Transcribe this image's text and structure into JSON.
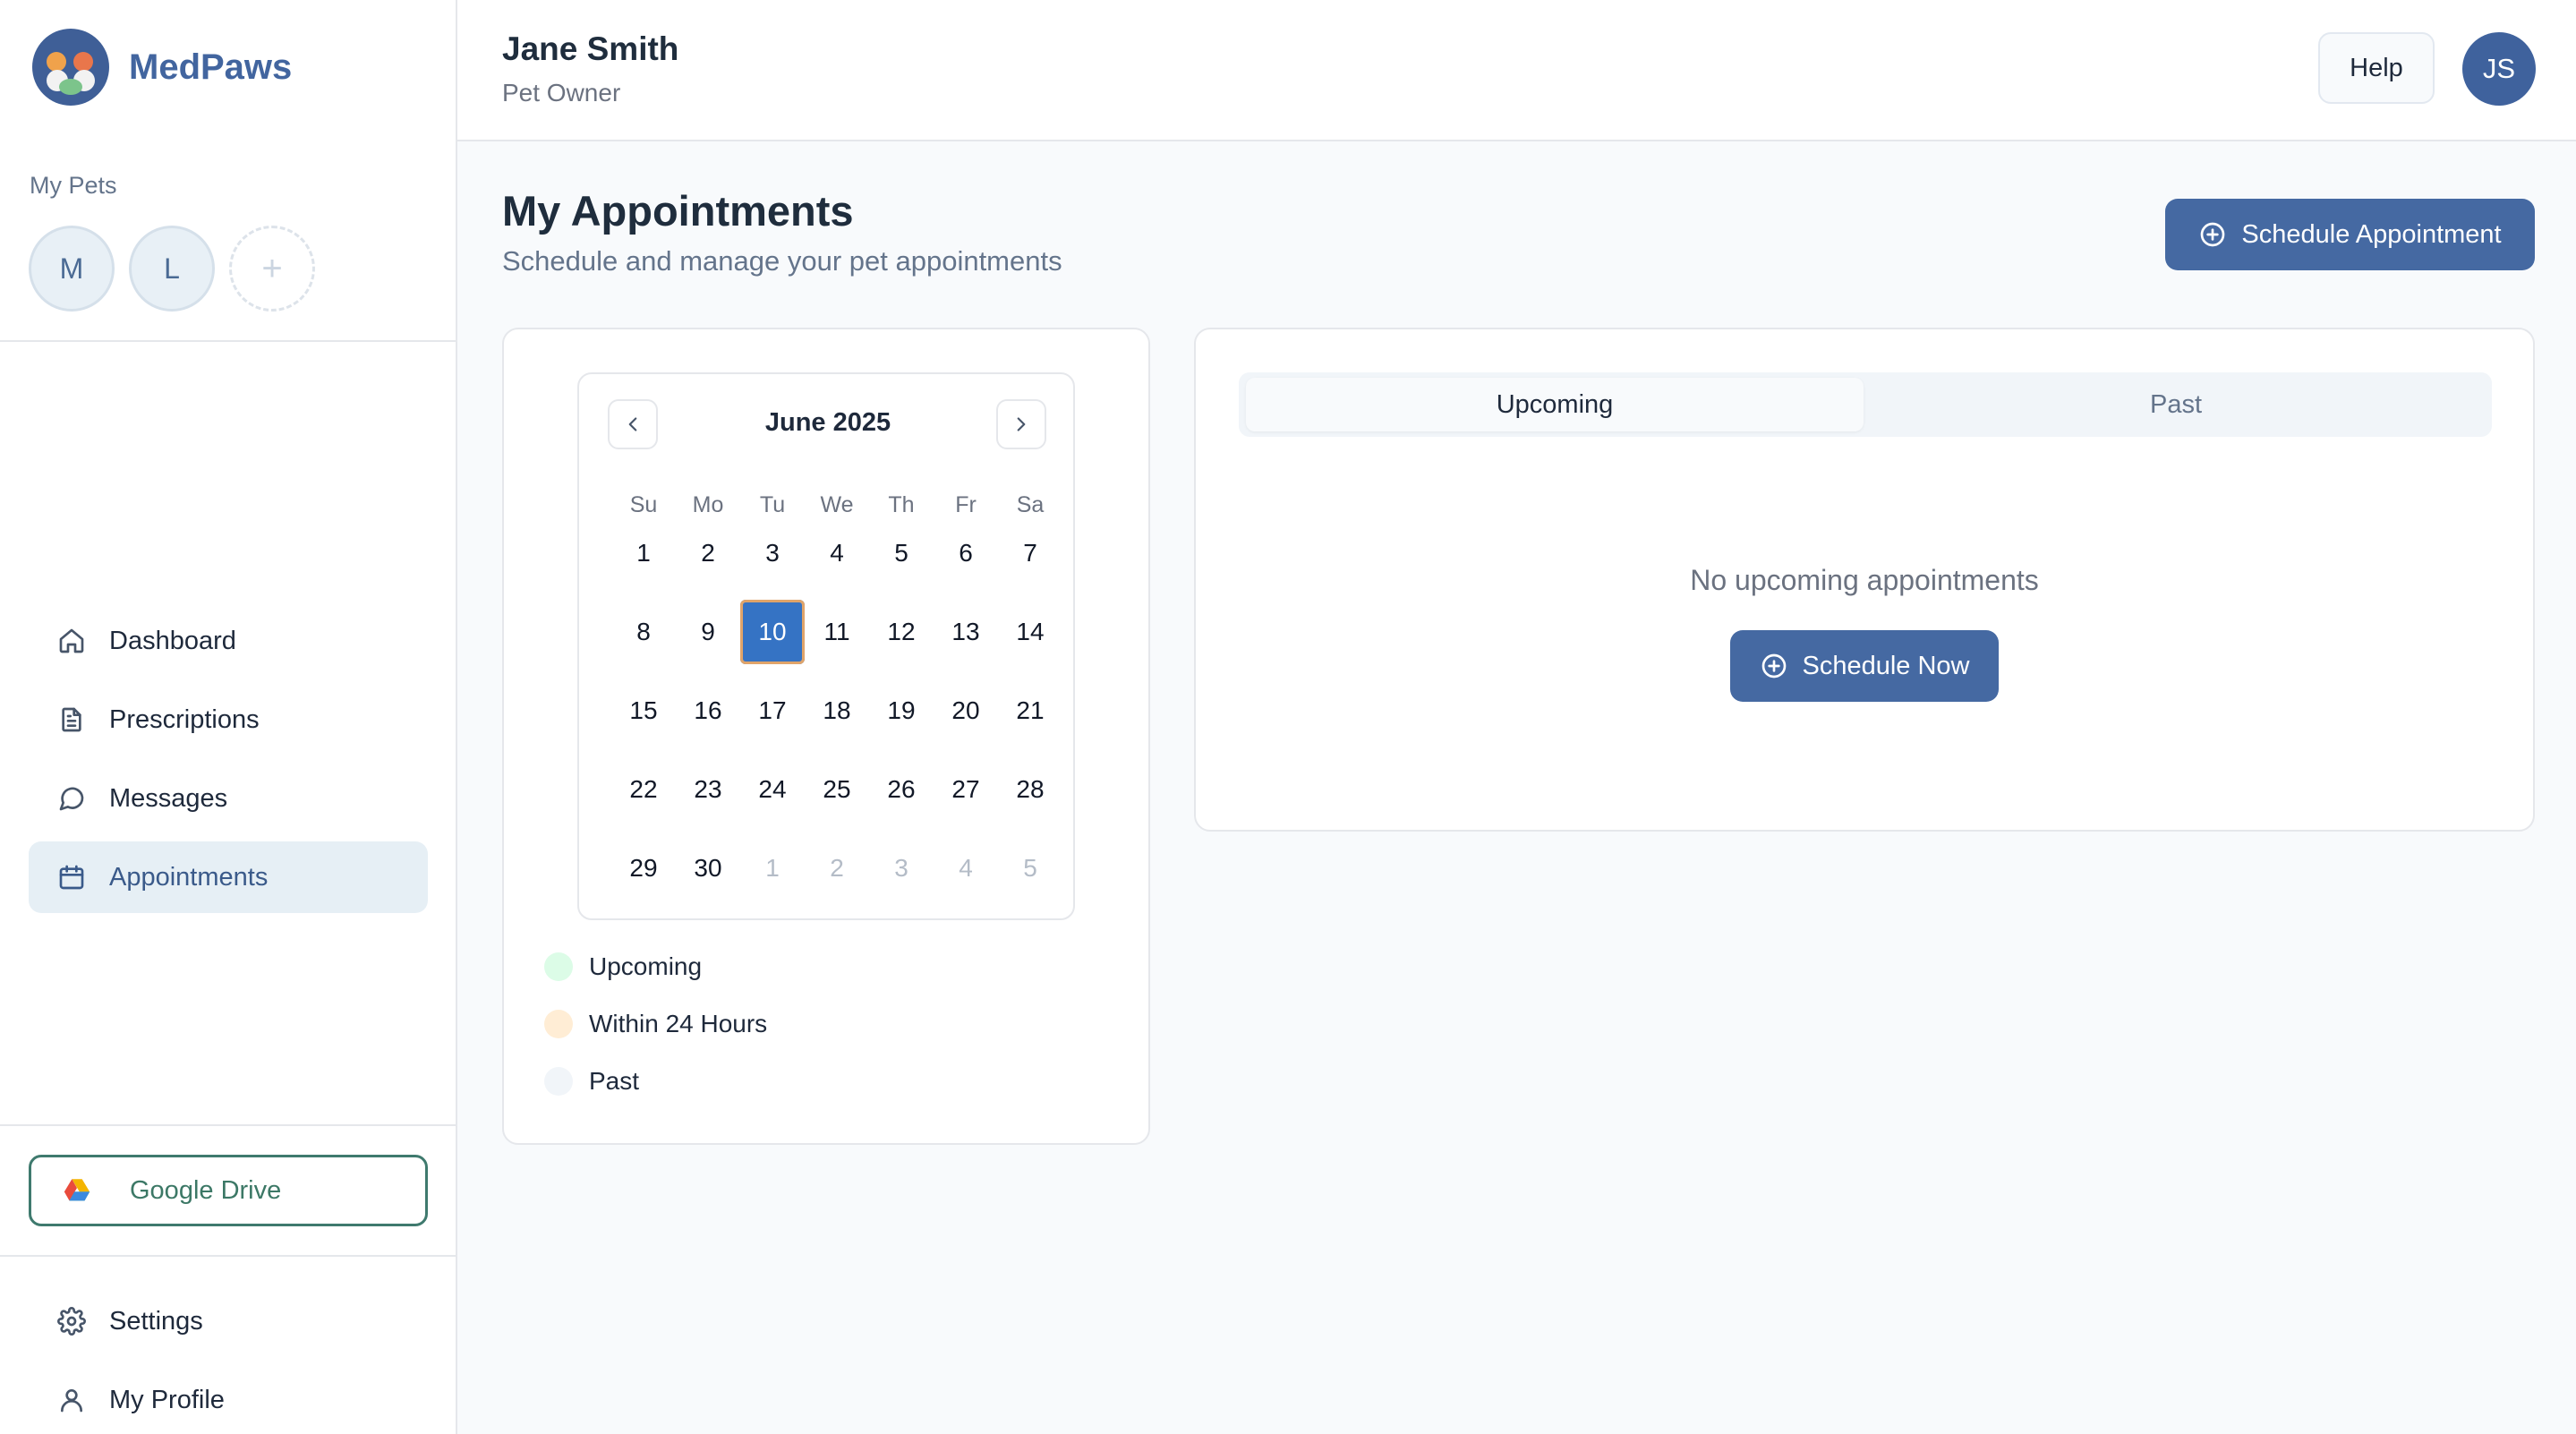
{
  "app": {
    "name": "MedPaws"
  },
  "sidebar": {
    "pets_label": "My Pets",
    "pets": [
      "M",
      "L"
    ],
    "add_pet": "+",
    "nav": [
      {
        "label": "Dashboard",
        "icon": "home-icon"
      },
      {
        "label": "Prescriptions",
        "icon": "document-icon"
      },
      {
        "label": "Messages",
        "icon": "chat-icon"
      },
      {
        "label": "Appointments",
        "icon": "calendar-icon",
        "active": true
      }
    ],
    "gdrive": {
      "label": "Google Drive",
      "icon": "google-drive-icon"
    },
    "bottom_nav": [
      {
        "label": "Settings",
        "icon": "gear-icon"
      },
      {
        "label": "My Profile",
        "icon": "user-icon"
      }
    ]
  },
  "header": {
    "user_name": "Jane Smith",
    "user_role": "Pet Owner",
    "help_label": "Help",
    "avatar_initials": "JS"
  },
  "page": {
    "title": "My Appointments",
    "subtitle": "Schedule and manage your pet appointments",
    "schedule_button": "Schedule Appointment"
  },
  "calendar": {
    "month_label": "June 2025",
    "weekdays": [
      "Su",
      "Mo",
      "Tu",
      "We",
      "Th",
      "Fr",
      "Sa"
    ],
    "weeks": [
      [
        "1",
        "2",
        "3",
        "4",
        "5",
        "6",
        "7"
      ],
      [
        "8",
        "9",
        "10",
        "11",
        "12",
        "13",
        "14"
      ],
      [
        "15",
        "16",
        "17",
        "18",
        "19",
        "20",
        "21"
      ],
      [
        "22",
        "23",
        "24",
        "25",
        "26",
        "27",
        "28"
      ],
      [
        "29",
        "30",
        "1",
        "2",
        "3",
        "4",
        "5"
      ]
    ],
    "selected_day": "10",
    "outside_month_from_index": 30
  },
  "legend": [
    {
      "label": "Upcoming",
      "color": "#dcfce7"
    },
    {
      "label": "Within 24 Hours",
      "color": "#ffedd5"
    },
    {
      "label": "Past",
      "color": "#f1f5f9"
    }
  ],
  "appointments": {
    "tabs": [
      {
        "label": "Upcoming",
        "active": true
      },
      {
        "label": "Past",
        "active": false
      }
    ],
    "empty_message": "No upcoming appointments",
    "schedule_now_label": "Schedule Now"
  },
  "colors": {
    "brand": "#42659f",
    "primary_button": "#4569a2",
    "selected_day": "#3573c4",
    "google_drive_border": "#3f7a6e"
  }
}
